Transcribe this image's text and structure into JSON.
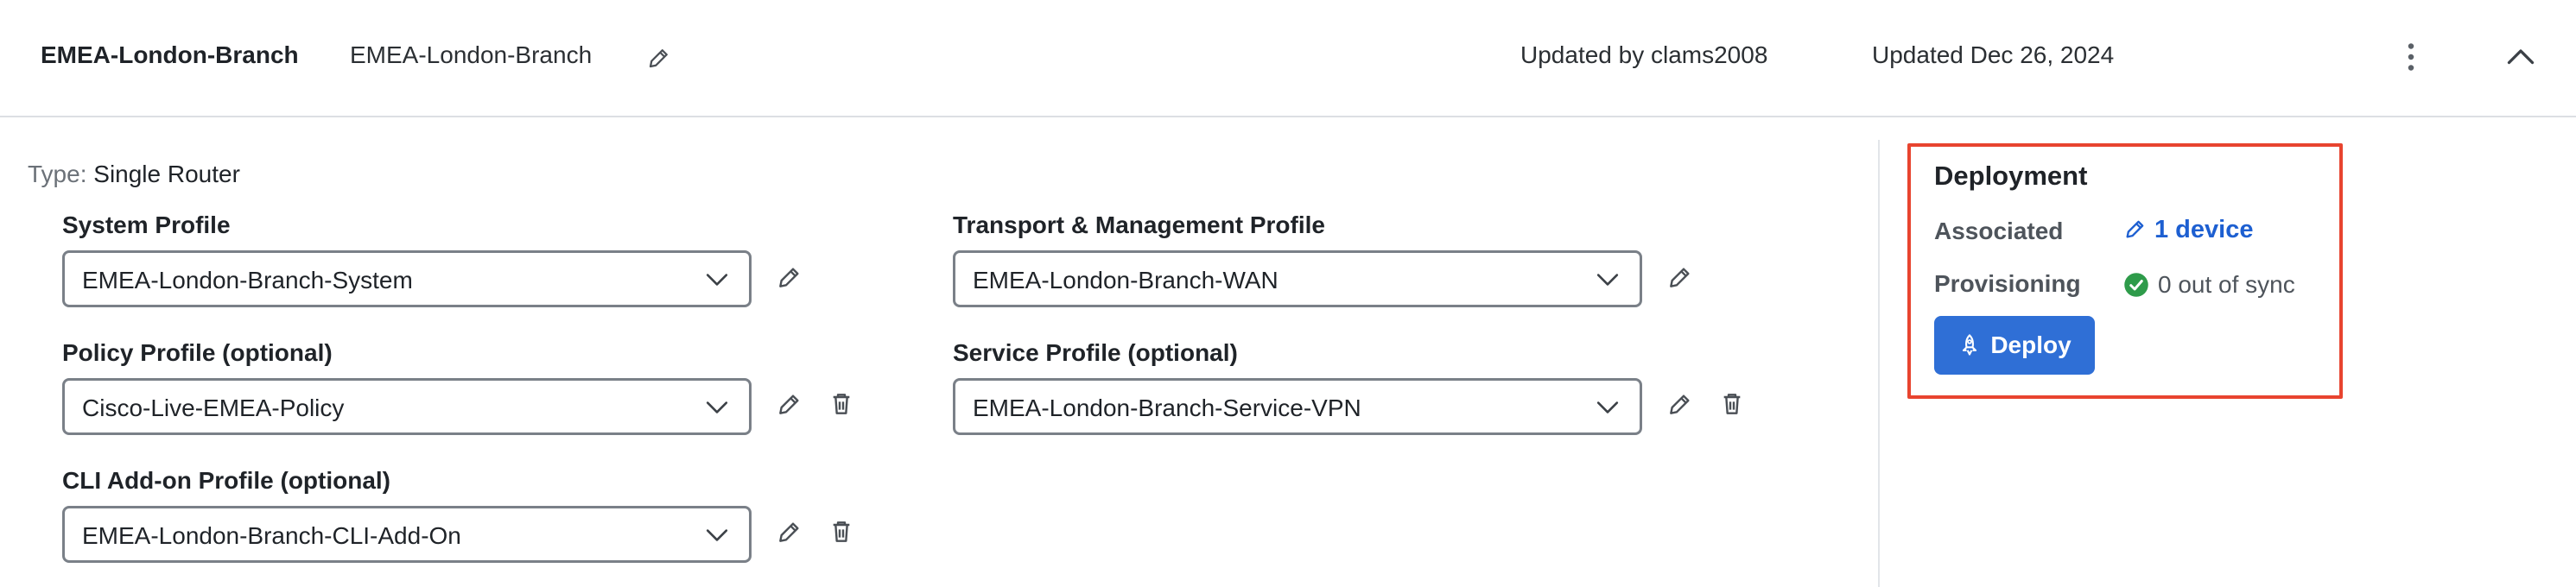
{
  "header": {
    "title": "EMEA-London-Branch",
    "name": "EMEA-London-Branch",
    "updated_by": "Updated by clams2008",
    "updated": "Updated Dec 26, 2024",
    "icons": {
      "edit": "pencil-icon",
      "menu": "more-vertical-icon",
      "collapse": "chevron-up-icon"
    }
  },
  "type": {
    "label": "Type:",
    "value": "Single Router"
  },
  "profiles": {
    "system": {
      "label": "System Profile",
      "value": "EMEA-London-Branch-System"
    },
    "transport": {
      "label": "Transport & Management Profile",
      "value": "EMEA-London-Branch-WAN"
    },
    "policy": {
      "label": "Policy Profile (optional)",
      "value": "Cisco-Live-EMEA-Policy"
    },
    "service": {
      "label": "Service Profile (optional)",
      "value": "EMEA-London-Branch-Service-VPN"
    },
    "cli": {
      "label": "CLI Add-on Profile (optional)",
      "value": "EMEA-London-Branch-CLI-Add-On"
    }
  },
  "deployment": {
    "title": "Deployment",
    "associated_label": "Associated",
    "associated_value": "1 device",
    "provisioning_label": "Provisioning",
    "provisioning_value": "0 out of sync",
    "deploy_label": "Deploy",
    "highlight_color": "#e8442f",
    "accent_color": "#2f6fd6",
    "status_color": "#2e9b4a"
  }
}
